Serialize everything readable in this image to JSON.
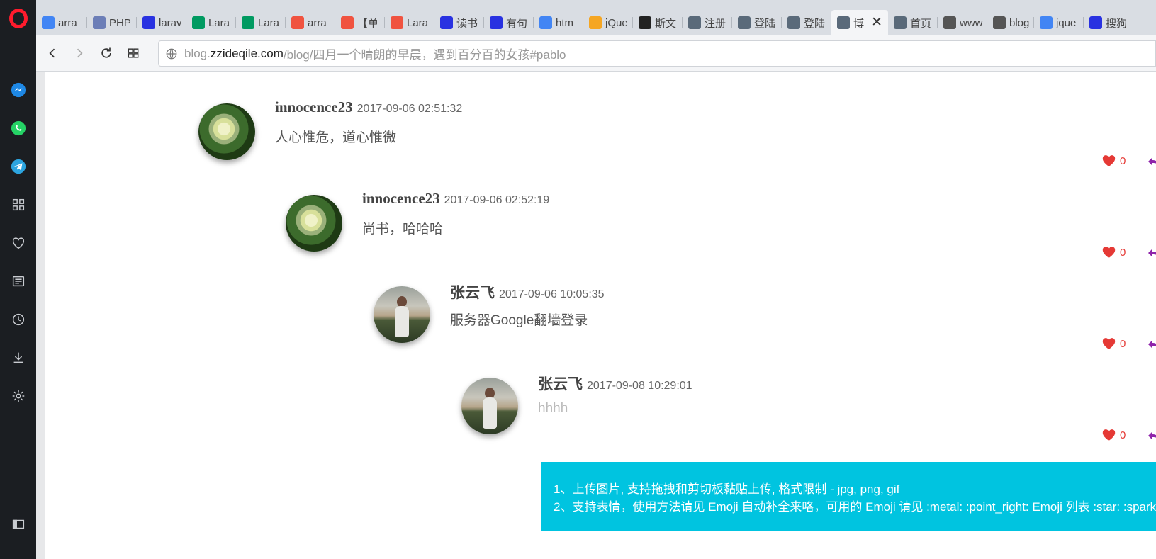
{
  "browser": {
    "tabs": [
      {
        "label": "arra",
        "icon": "google-icon",
        "color": "#4285f4"
      },
      {
        "label": "PHP",
        "icon": "php-icon",
        "color": "#6c7eb7"
      },
      {
        "label": "larav",
        "icon": "baidu-paw-icon",
        "color": "#2932e1"
      },
      {
        "label": "Lara",
        "icon": "segmentfault-icon",
        "color": "#009a61"
      },
      {
        "label": "Lara",
        "icon": "segmentfault-icon",
        "color": "#009a61"
      },
      {
        "label": "arra",
        "icon": "laravel-icon",
        "color": "#f05340"
      },
      {
        "label": "【单",
        "icon": "laravel-icon",
        "color": "#f05340"
      },
      {
        "label": "Lara",
        "icon": "laravel-icon",
        "color": "#f05340"
      },
      {
        "label": "读书",
        "icon": "baidu-paw-icon",
        "color": "#2932e1"
      },
      {
        "label": "有句",
        "icon": "baidu-paw-icon",
        "color": "#2932e1"
      },
      {
        "label": "htm",
        "icon": "google-icon",
        "color": "#4285f4"
      },
      {
        "label": "jQue",
        "icon": "q-search-icon",
        "color": "#f5a623"
      },
      {
        "label": "斯文",
        "icon": "zhi-icon",
        "color": "#222222"
      },
      {
        "label": "注册",
        "icon": "lantern-icon",
        "color": "#5a6a7a"
      },
      {
        "label": "登陆",
        "icon": "lantern-icon",
        "color": "#5a6a7a"
      },
      {
        "label": "登陆",
        "icon": "lantern-icon",
        "color": "#5a6a7a"
      },
      {
        "label": "博",
        "icon": "lantern-icon",
        "color": "#5a6a7a",
        "active": true
      },
      {
        "label": "首页",
        "icon": "lantern-icon",
        "color": "#5a6a7a"
      },
      {
        "label": "www",
        "icon": "file-icon",
        "color": "#555555"
      },
      {
        "label": "blog",
        "icon": "file-icon",
        "color": "#555555"
      },
      {
        "label": "jque",
        "icon": "google-icon",
        "color": "#4285f4"
      },
      {
        "label": "搜狗",
        "icon": "baidu-paw-icon",
        "color": "#2932e1"
      }
    ],
    "url": {
      "prefix": "blog.",
      "domain": "zzideqile.com",
      "path": "/blog/四月一个晴朗的早晨，遇到百分百的女孩#pablo"
    }
  },
  "comments": [
    {
      "user": "innocence23",
      "date": "2017-09-06 02:51:32",
      "text": "人心惟危，道心惟微",
      "likes": "0",
      "avatar": "flower"
    },
    {
      "user": "innocence23",
      "date": "2017-09-06 02:52:19",
      "text": "尚书，哈哈哈",
      "likes": "0",
      "avatar": "flower"
    },
    {
      "user": "张云飞",
      "date": "2017-09-06 10:05:35",
      "text": "服务器Google翻墙登录",
      "likes": "0",
      "avatar": "person"
    },
    {
      "user": "张云飞",
      "date": "2017-09-08 10:29:01",
      "text": "hhhh",
      "likes": "0",
      "avatar": "person"
    }
  ],
  "tips": {
    "line1": "1、上传图片, 支持拖拽和剪切板黏贴上传, 格式限制 - jpg, png, gif",
    "line2": "2、支持表情，使用方法请见 Emoji 自动补全来咯，可用的 Emoji 请见 :metal: :point_right: Emoji 列表 :star: :sparkles:"
  },
  "colors": {
    "accent": "#00c4e0",
    "like": "#e53935",
    "reply": "#8e24aa",
    "opera_red": "#ff1b2d"
  }
}
